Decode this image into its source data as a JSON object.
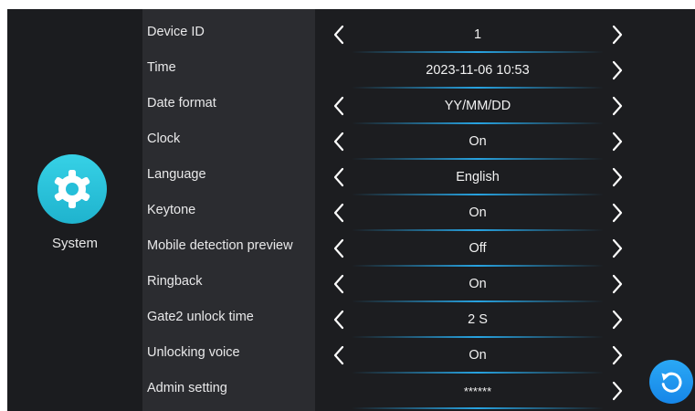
{
  "sidebar": {
    "title": "System",
    "icon": "gear-icon",
    "accent": "#2cc3dc"
  },
  "settings": [
    {
      "label": "Device ID",
      "value": "1",
      "has_left_arrow": true
    },
    {
      "label": "Time",
      "value": "2023-11-06  10:53",
      "has_left_arrow": false
    },
    {
      "label": "Date format",
      "value": "YY/MM/DD",
      "has_left_arrow": true
    },
    {
      "label": "Clock",
      "value": "On",
      "has_left_arrow": true
    },
    {
      "label": "Language",
      "value": "English",
      "has_left_arrow": true
    },
    {
      "label": "Keytone",
      "value": "On",
      "has_left_arrow": true
    },
    {
      "label": "Mobile detection preview",
      "value": "Off",
      "has_left_arrow": true
    },
    {
      "label": "Ringback",
      "value": "On",
      "has_left_arrow": true
    },
    {
      "label": "Gate2 unlock time",
      "value": "2 S",
      "has_left_arrow": true
    },
    {
      "label": "Unlocking voice",
      "value": "On",
      "has_left_arrow": true
    },
    {
      "label": "Admin setting",
      "value": "******",
      "has_left_arrow": false
    }
  ],
  "refresh": {
    "icon": "refresh-icon",
    "color": "#1e97ef"
  }
}
